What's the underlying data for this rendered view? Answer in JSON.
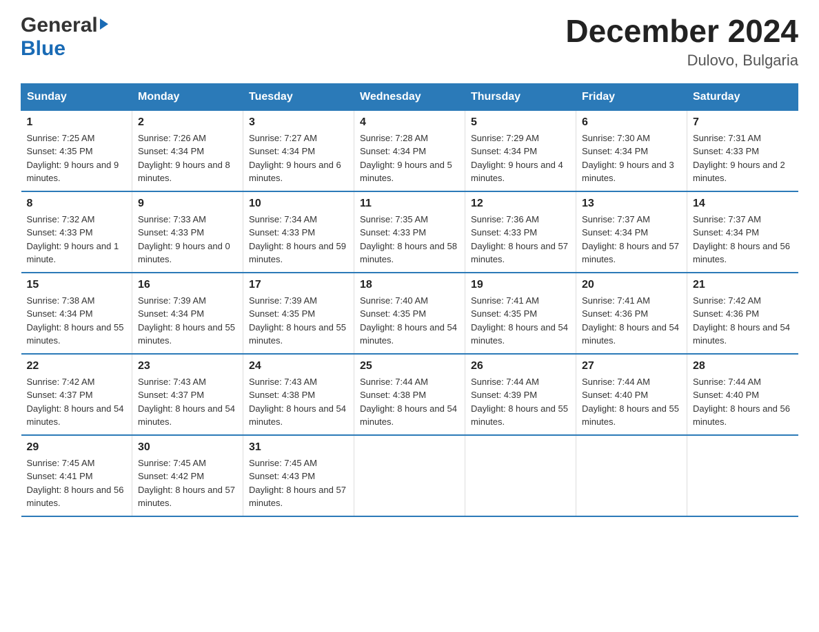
{
  "header": {
    "logo_general": "General",
    "logo_blue": "Blue",
    "month_year": "December 2024",
    "location": "Dulovo, Bulgaria"
  },
  "days_of_week": [
    "Sunday",
    "Monday",
    "Tuesday",
    "Wednesday",
    "Thursday",
    "Friday",
    "Saturday"
  ],
  "weeks": [
    [
      {
        "day": "1",
        "sunrise": "7:25 AM",
        "sunset": "4:35 PM",
        "daylight": "9 hours and 9 minutes."
      },
      {
        "day": "2",
        "sunrise": "7:26 AM",
        "sunset": "4:34 PM",
        "daylight": "9 hours and 8 minutes."
      },
      {
        "day": "3",
        "sunrise": "7:27 AM",
        "sunset": "4:34 PM",
        "daylight": "9 hours and 6 minutes."
      },
      {
        "day": "4",
        "sunrise": "7:28 AM",
        "sunset": "4:34 PM",
        "daylight": "9 hours and 5 minutes."
      },
      {
        "day": "5",
        "sunrise": "7:29 AM",
        "sunset": "4:34 PM",
        "daylight": "9 hours and 4 minutes."
      },
      {
        "day": "6",
        "sunrise": "7:30 AM",
        "sunset": "4:34 PM",
        "daylight": "9 hours and 3 minutes."
      },
      {
        "day": "7",
        "sunrise": "7:31 AM",
        "sunset": "4:33 PM",
        "daylight": "9 hours and 2 minutes."
      }
    ],
    [
      {
        "day": "8",
        "sunrise": "7:32 AM",
        "sunset": "4:33 PM",
        "daylight": "9 hours and 1 minute."
      },
      {
        "day": "9",
        "sunrise": "7:33 AM",
        "sunset": "4:33 PM",
        "daylight": "9 hours and 0 minutes."
      },
      {
        "day": "10",
        "sunrise": "7:34 AM",
        "sunset": "4:33 PM",
        "daylight": "8 hours and 59 minutes."
      },
      {
        "day": "11",
        "sunrise": "7:35 AM",
        "sunset": "4:33 PM",
        "daylight": "8 hours and 58 minutes."
      },
      {
        "day": "12",
        "sunrise": "7:36 AM",
        "sunset": "4:33 PM",
        "daylight": "8 hours and 57 minutes."
      },
      {
        "day": "13",
        "sunrise": "7:37 AM",
        "sunset": "4:34 PM",
        "daylight": "8 hours and 57 minutes."
      },
      {
        "day": "14",
        "sunrise": "7:37 AM",
        "sunset": "4:34 PM",
        "daylight": "8 hours and 56 minutes."
      }
    ],
    [
      {
        "day": "15",
        "sunrise": "7:38 AM",
        "sunset": "4:34 PM",
        "daylight": "8 hours and 55 minutes."
      },
      {
        "day": "16",
        "sunrise": "7:39 AM",
        "sunset": "4:34 PM",
        "daylight": "8 hours and 55 minutes."
      },
      {
        "day": "17",
        "sunrise": "7:39 AM",
        "sunset": "4:35 PM",
        "daylight": "8 hours and 55 minutes."
      },
      {
        "day": "18",
        "sunrise": "7:40 AM",
        "sunset": "4:35 PM",
        "daylight": "8 hours and 54 minutes."
      },
      {
        "day": "19",
        "sunrise": "7:41 AM",
        "sunset": "4:35 PM",
        "daylight": "8 hours and 54 minutes."
      },
      {
        "day": "20",
        "sunrise": "7:41 AM",
        "sunset": "4:36 PM",
        "daylight": "8 hours and 54 minutes."
      },
      {
        "day": "21",
        "sunrise": "7:42 AM",
        "sunset": "4:36 PM",
        "daylight": "8 hours and 54 minutes."
      }
    ],
    [
      {
        "day": "22",
        "sunrise": "7:42 AM",
        "sunset": "4:37 PM",
        "daylight": "8 hours and 54 minutes."
      },
      {
        "day": "23",
        "sunrise": "7:43 AM",
        "sunset": "4:37 PM",
        "daylight": "8 hours and 54 minutes."
      },
      {
        "day": "24",
        "sunrise": "7:43 AM",
        "sunset": "4:38 PM",
        "daylight": "8 hours and 54 minutes."
      },
      {
        "day": "25",
        "sunrise": "7:44 AM",
        "sunset": "4:38 PM",
        "daylight": "8 hours and 54 minutes."
      },
      {
        "day": "26",
        "sunrise": "7:44 AM",
        "sunset": "4:39 PM",
        "daylight": "8 hours and 55 minutes."
      },
      {
        "day": "27",
        "sunrise": "7:44 AM",
        "sunset": "4:40 PM",
        "daylight": "8 hours and 55 minutes."
      },
      {
        "day": "28",
        "sunrise": "7:44 AM",
        "sunset": "4:40 PM",
        "daylight": "8 hours and 56 minutes."
      }
    ],
    [
      {
        "day": "29",
        "sunrise": "7:45 AM",
        "sunset": "4:41 PM",
        "daylight": "8 hours and 56 minutes."
      },
      {
        "day": "30",
        "sunrise": "7:45 AM",
        "sunset": "4:42 PM",
        "daylight": "8 hours and 57 minutes."
      },
      {
        "day": "31",
        "sunrise": "7:45 AM",
        "sunset": "4:43 PM",
        "daylight": "8 hours and 57 minutes."
      },
      null,
      null,
      null,
      null
    ]
  ],
  "labels": {
    "sunrise": "Sunrise:",
    "sunset": "Sunset:",
    "daylight": "Daylight:"
  }
}
